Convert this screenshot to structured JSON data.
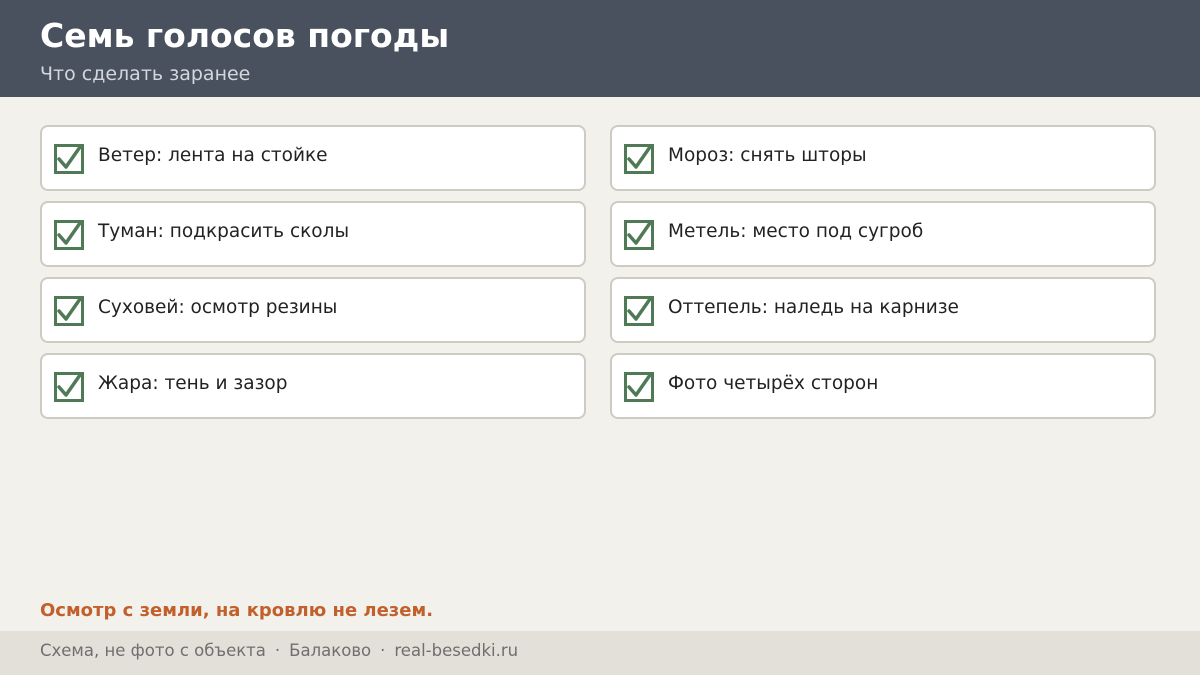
{
  "header": {
    "title": "Семь голосов погоды",
    "subtitle": "Что сделать заранее"
  },
  "colors": {
    "header_bg": "#48515d",
    "page_bg": "#f3f1ec",
    "check_green": "#4f7a55",
    "note_orange": "#c2602c",
    "footer_bg": "#e3e0da"
  },
  "checklist": {
    "items": [
      {
        "label": "Ветер: лента на стойке",
        "checked": true,
        "icon": "checkbox-checked-icon"
      },
      {
        "label": "Мороз: снять шторы",
        "checked": true,
        "icon": "checkbox-checked-icon"
      },
      {
        "label": "Туман: подкрасить сколы",
        "checked": true,
        "icon": "checkbox-checked-icon"
      },
      {
        "label": "Метель: место под сугроб",
        "checked": true,
        "icon": "checkbox-checked-icon"
      },
      {
        "label": "Суховей: осмотр резины",
        "checked": true,
        "icon": "checkbox-checked-icon"
      },
      {
        "label": "Оттепель: наледь на карнизе",
        "checked": true,
        "icon": "checkbox-checked-icon"
      },
      {
        "label": "Жара: тень и зазор",
        "checked": true,
        "icon": "checkbox-checked-icon"
      },
      {
        "label": "Фото четырёх сторон",
        "checked": true,
        "icon": "checkbox-checked-icon"
      }
    ]
  },
  "note": "Осмотр с земли, на кровлю не лезем.",
  "footer": {
    "disclaimer": "Схема, не фото с объекта",
    "separator": "·",
    "city": "Балаково",
    "site": "real-besedki.ru"
  }
}
